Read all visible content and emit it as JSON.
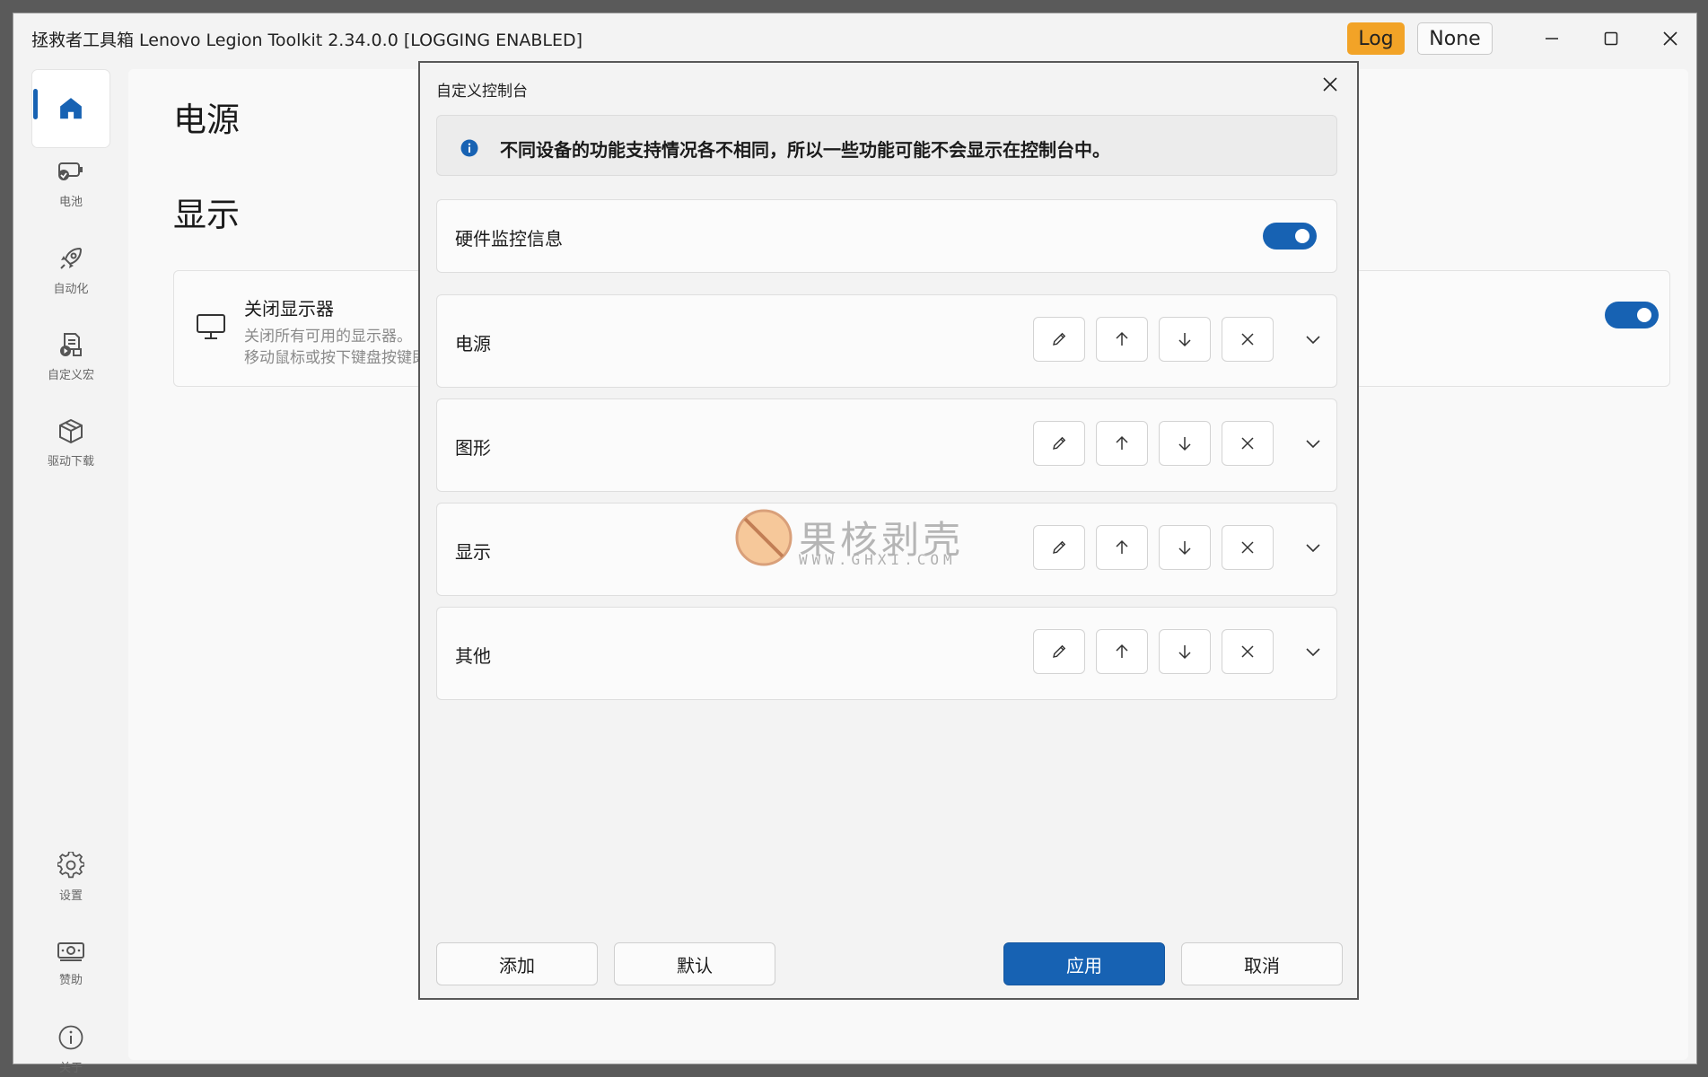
{
  "window": {
    "title": "拯救者工具箱 Lenovo Legion Toolkit 2.34.0.0 [LOGGING ENABLED]",
    "log_label": "Log",
    "none_label": "None"
  },
  "sidebar": {
    "items": [
      {
        "label": "电池",
        "icon": "battery-icon"
      },
      {
        "label": "自动化",
        "icon": "rocket-icon"
      },
      {
        "label": "自定义宏",
        "icon": "macro-icon"
      },
      {
        "label": "驱动下载",
        "icon": "package-icon"
      },
      {
        "label": "设置",
        "icon": "gear-icon"
      },
      {
        "label": "赞助",
        "icon": "money-icon"
      },
      {
        "label": "关于",
        "icon": "info-icon"
      }
    ]
  },
  "main": {
    "heading_power": "电源",
    "heading_display": "显示",
    "card": {
      "title": "关闭显示器",
      "desc_line1": "关闭所有可用的显示器。",
      "desc_line2": "移动鼠标或按下键盘按键即"
    }
  },
  "dialog": {
    "title": "自定义控制台",
    "info": "不同设备的功能支持情况各不相同，所以一些功能可能不会显示在控制台中。",
    "hw_monitor_label": "硬件监控信息",
    "hw_monitor_on": true,
    "sections": [
      {
        "label": "电源"
      },
      {
        "label": "图形"
      },
      {
        "label": "显示"
      },
      {
        "label": "其他"
      }
    ],
    "buttons": {
      "add": "添加",
      "default": "默认",
      "apply": "应用",
      "cancel": "取消"
    }
  },
  "watermark": {
    "text": "果核剥壳",
    "sub": "WWW.GHXI.COM"
  },
  "colors": {
    "accent": "#1762b3",
    "log": "#f2a327"
  }
}
